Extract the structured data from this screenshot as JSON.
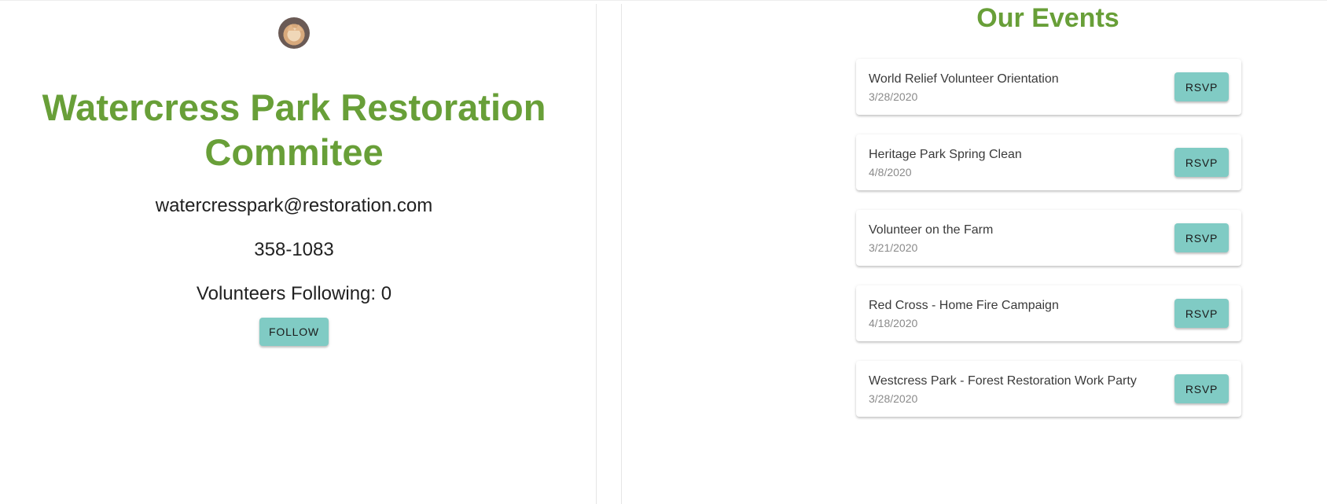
{
  "organization": {
    "name": "Watercress Park Restoration Commitee",
    "email": "watercresspark@restoration.com",
    "phone": "358-1083",
    "followers_text": "Volunteers Following: 0",
    "follow_label": "FOLLOW"
  },
  "events_section": {
    "title": "Our Events",
    "rsvp_label": "RSVP",
    "events": [
      {
        "name": "World Relief Volunteer Orientation",
        "date": "3/28/2020"
      },
      {
        "name": "Heritage Park Spring Clean",
        "date": "4/8/2020"
      },
      {
        "name": "Volunteer on the Farm",
        "date": "3/21/2020"
      },
      {
        "name": "Red Cross - Home Fire Campaign",
        "date": "4/18/2020"
      },
      {
        "name": "Westcress Park - Forest Restoration Work Party",
        "date": "3/28/2020"
      }
    ]
  },
  "colors": {
    "accent_green": "#689f38",
    "button_teal": "#80cbc4"
  },
  "icons": {
    "avatar": "cat-photo-avatar"
  }
}
